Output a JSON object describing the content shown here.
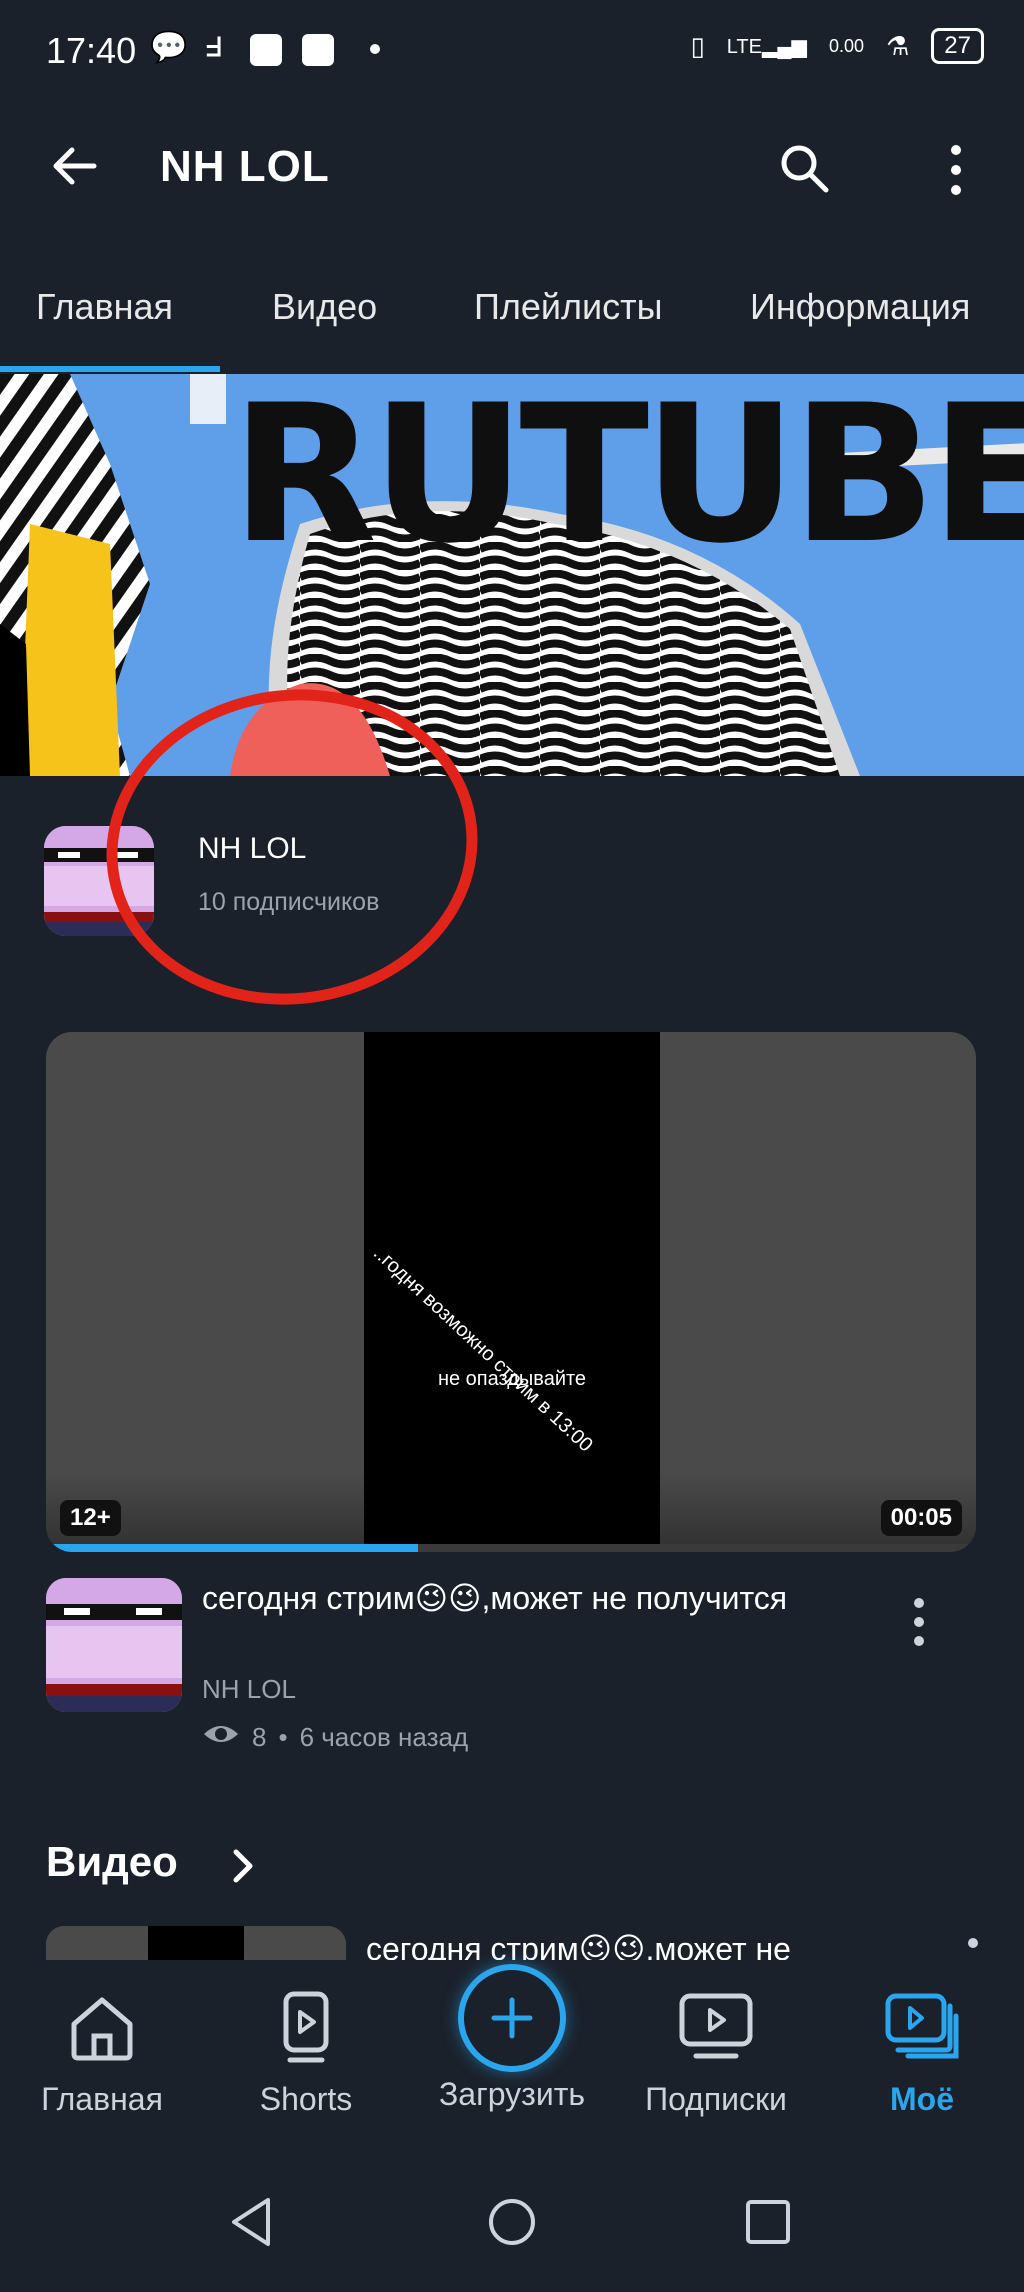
{
  "status_bar": {
    "time": "17:40",
    "battery": "27"
  },
  "header": {
    "title": "NH LOL"
  },
  "tabs": [
    {
      "label": "Главная",
      "active": true
    },
    {
      "label": "Видео"
    },
    {
      "label": "Плейлисты"
    },
    {
      "label": "Информация"
    }
  ],
  "banner": {
    "text": "RUTUBE"
  },
  "channel": {
    "name": "NH LOL",
    "subscribers": "10 подписчиков"
  },
  "featured_video": {
    "overlay_line1": "..годня возможно стрим в 13:00",
    "overlay_line2": "не опаздывайте",
    "age_badge": "12+",
    "duration": "00:05",
    "progress": 0.4,
    "title": "сегодня стрим😉😉,может не получится",
    "channel": "NH LOL",
    "views": "8",
    "age": "6 часов назад",
    "meta_sep": "•"
  },
  "videos_section": {
    "title": "Видео",
    "first_title": "сегодня стрим😉😉,может не"
  },
  "bottom_nav": [
    {
      "label": "Главная",
      "icon": "home-icon"
    },
    {
      "label": "Shorts",
      "icon": "shorts-icon"
    },
    {
      "label": "Загрузить",
      "icon": "upload-plus-icon"
    },
    {
      "label": "Подписки",
      "icon": "subscriptions-icon"
    },
    {
      "label": "Моё",
      "icon": "my-library-icon",
      "active": true
    }
  ],
  "colors": {
    "accent": "#2aa6ee",
    "background": "#1b212b",
    "annotation_red": "#e2231a"
  }
}
